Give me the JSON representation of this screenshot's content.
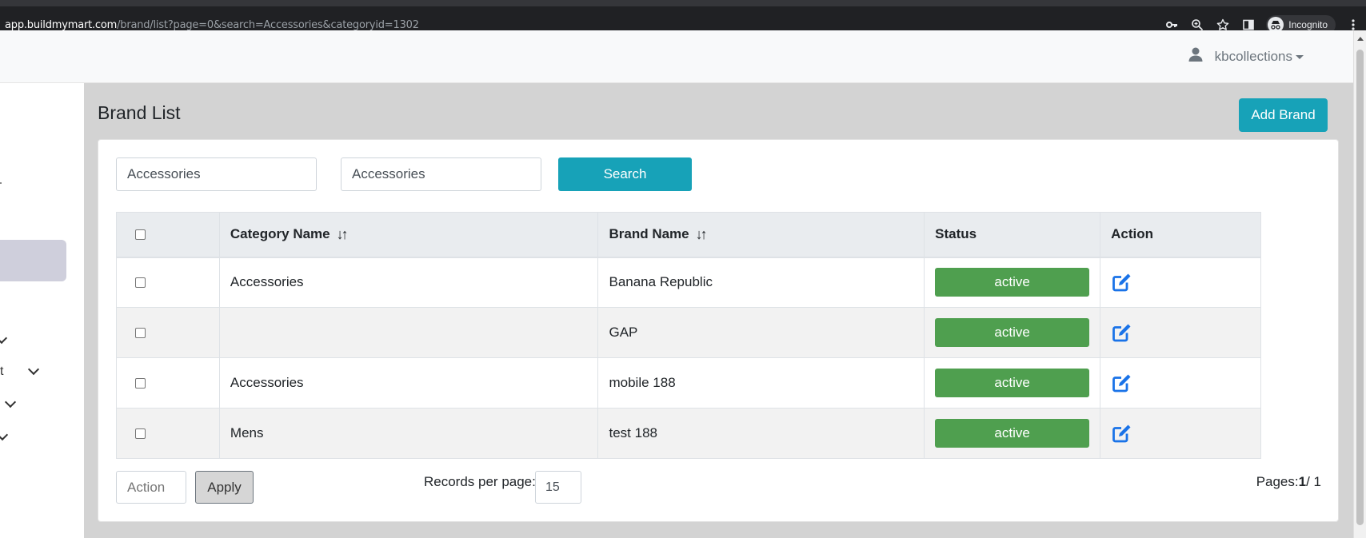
{
  "browser": {
    "url_host": "app.buildmymart.com",
    "url_path": "/brand/list?page=0&search=Accessories&categoryid=1302",
    "incognito_label": "Incognito",
    "icons": [
      "key-icon",
      "zoom-icon",
      "star-icon",
      "sidepanel-icon",
      "incognito-icon",
      "menu-kebab-icon"
    ]
  },
  "header": {
    "username": "kbcollections"
  },
  "sidebar": {
    "partial_label": "t"
  },
  "page": {
    "title": "Brand List",
    "add_button": "Add Brand"
  },
  "filters": {
    "category_value": "Accessories",
    "brand_value": "Accessories",
    "search_button": "Search"
  },
  "table": {
    "columns": [
      "",
      "Category Name",
      "Brand Name",
      "Status",
      "Action"
    ],
    "rows": [
      {
        "category": "Accessories",
        "brand": "Banana Republic",
        "status": "active"
      },
      {
        "category": "",
        "brand": "GAP",
        "status": "active"
      },
      {
        "category": "Accessories",
        "brand": "mobile 188",
        "status": "active"
      },
      {
        "category": "Mens",
        "brand": "test 188",
        "status": "active"
      }
    ]
  },
  "footer": {
    "action_placeholder": "Action",
    "apply_button": "Apply",
    "records_label": "Records per page:",
    "records_value": "15",
    "pages_label": "Pages:",
    "current_page": "1",
    "total_pages": "/ 1"
  },
  "colors": {
    "accent": "#17a2b8",
    "status_active": "#4f9f4f",
    "edit_icon": "#1a73e8"
  }
}
